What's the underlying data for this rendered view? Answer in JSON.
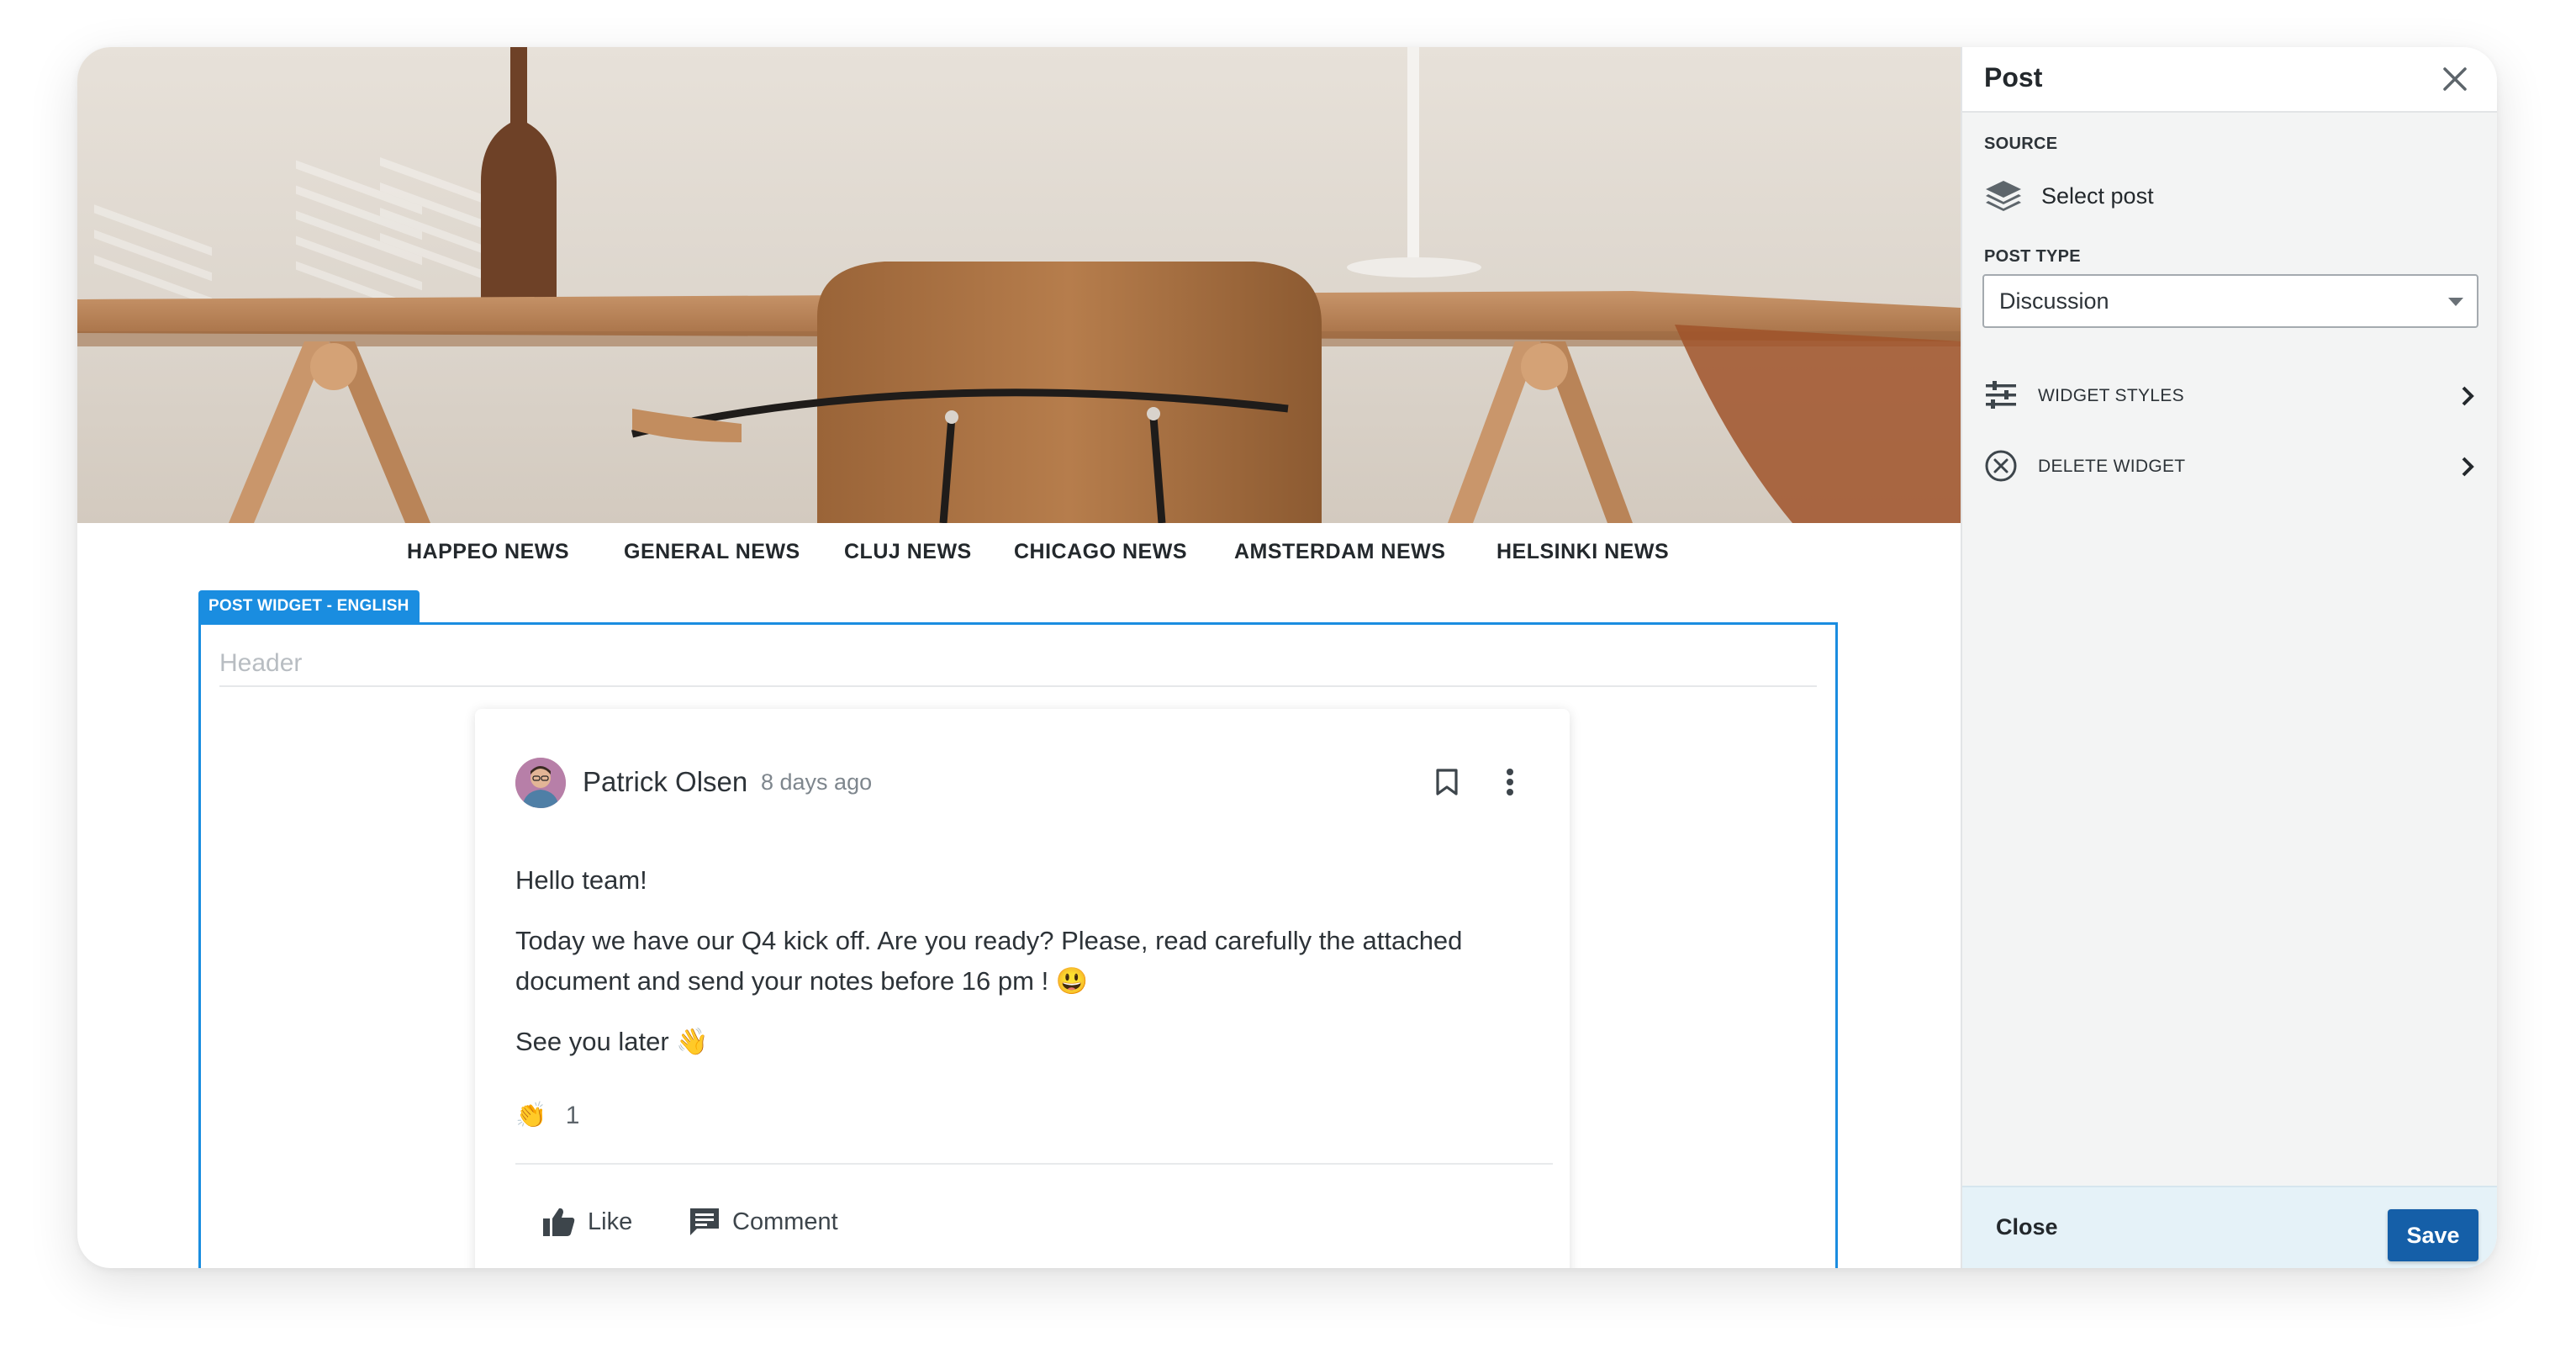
{
  "nav": {
    "items": [
      {
        "label": "HAPPEO NEWS"
      },
      {
        "label": "GENERAL NEWS"
      },
      {
        "label": "CLUJ NEWS"
      },
      {
        "label": "CHICAGO NEWS"
      },
      {
        "label": "AMSTERDAM NEWS"
      },
      {
        "label": "HELSINKI NEWS"
      }
    ]
  },
  "widget": {
    "tag": "POST WIDGET - ENGLISH",
    "header_placeholder": "Header"
  },
  "post": {
    "author": "Patrick Olsen",
    "time_ago": "8 days ago",
    "greeting": "Hello team!",
    "paragraph": "Today we have our Q4 kick off. Are you ready? Please, read carefully the attached document and send your notes before 16 pm ! 😃",
    "signoff": "See you later 👋",
    "reaction_emoji": "👏",
    "reaction_count": "1",
    "like_label": "Like",
    "comment_label": "Comment"
  },
  "panel": {
    "title": "Post",
    "source_label": "SOURCE",
    "select_post_label": "Select post",
    "post_type_label": "POST TYPE",
    "post_type_value": "Discussion",
    "widget_styles_label": "WIDGET STYLES",
    "delete_widget_label": "DELETE WIDGET",
    "close_label": "Close",
    "save_label": "Save"
  },
  "colors": {
    "accent": "#1a8de0",
    "save_button": "#155fa8",
    "footer_bg": "#e5f2f8"
  }
}
